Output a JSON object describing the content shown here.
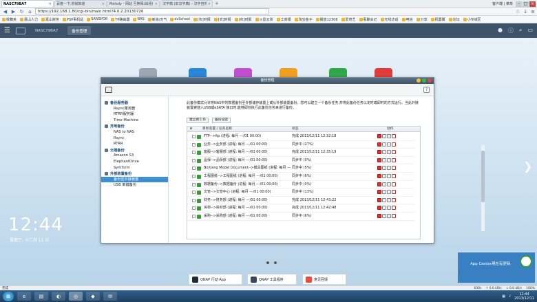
{
  "browser": {
    "tabs": [
      {
        "label": "NASC79BA7",
        "active": true
      },
      {
        "label": "百度一下,你就知道",
        "active": false
      },
      {
        "label": "Melody - 网站 互换网(出租)",
        "active": false
      },
      {
        "label": "汉字典 (旧汉字典) - 汉字自然",
        "active": false
      }
    ],
    "top_right_text": "客户端 | 菜单",
    "url": "https://192.168.1.80/cgi-bin/main.html?4.0.2.20130726",
    "bookmarks": [
      "收藏夹",
      "嘉山人力",
      "嘉山财务",
      "PSP事机站",
      "SANSPOR",
      "TP路由器",
      "NAS",
      "新浪/天气",
      "ecSchool",
      "[农]时报",
      "[农]时报",
      "[农]时报",
      "火星云资",
      "工商银",
      "淘宝金子",
      "播放12306",
      "爱奇艺",
      "看聚会记",
      "无线访谈",
      "电信",
      "分享",
      "机器翼",
      "论坛",
      "小专城区"
    ]
  },
  "qnap_bar": {
    "tab_label": "NASC79BA7",
    "backup_tab_label": "备份管理"
  },
  "desktop": {
    "clock": "12:44",
    "date": "星期三, 十二月 11 日",
    "dock": [
      {
        "label": "QNAP 行动 App"
      },
      {
        "label": "QNAP 工具程序"
      },
      {
        "label": "意见回馈"
      }
    ],
    "notification": "App Center現在有更新"
  },
  "window": {
    "title": "备份管理",
    "sidebar": [
      {
        "group": "备份服务器",
        "items": [
          "Rsync服务器",
          "RTRR服务器",
          "Time Machine"
        ]
      },
      {
        "group": "异地备份",
        "items": [
          "NAS to NAS",
          "Rsync",
          "RTRR"
        ]
      },
      {
        "group": "云端备份",
        "items": [
          "Amazon S3",
          "ElephantDrive",
          "Symform"
        ]
      },
      {
        "group": "外部装置备份",
        "items": [
          "备份至外接装置",
          "USB 单键备份"
        ]
      }
    ],
    "active_item": "备份至外接装置",
    "description": "此备份模式允许将NAS中的数据备份至外部储存装置上或从外部装置备份。您可以建立一个备份任务,并将此备份任务以定时或即时的方式运行。当此外接装置被插入USB或eSATA 接口时,能够即刻执行此备份任务来进行备份。",
    "buttons": {
      "create": "建立新工作",
      "options": "备份设定"
    },
    "columns": {
      "name": "目标装置 / 任务名称",
      "status": "状态",
      "action": "动作"
    },
    "rows": [
      {
        "name": "FTP-->ftp (进程: 每月 ---/01 00:00)",
        "status": "完成 2013/12/11 12:32:18"
      },
      {
        "name": "业务-->业务部 (进程: 每月 ---/01 00:00)",
        "status": "同步中 (27%)"
      },
      {
        "name": "客服-->客服部 (进程: 每月 ---/01 00:00)",
        "status": "完成 2013/12/11 12:35:19"
      },
      {
        "name": "品保-->品保部 (进程: 每月 ---/01 00:00)",
        "status": "同步中 (0%)"
      },
      {
        "name": "BoXiang Model Document-->模具图纸 (进程: 每月 ---/01 00:00)",
        "status": "同步中 (5%)"
      },
      {
        "name": "工程图纸-->工程图纸 (进程: 每月 ---/01 00:00)",
        "status": "同步中 (6%)"
      },
      {
        "name": "数据备份-->数据备份 (进程: 每月 ---/01 00:00)",
        "status": "同步中 (0%)"
      },
      {
        "name": "文管-->文管中心 (进程: 每月 ---/01 00:00)",
        "status": "同步中 (13%)"
      },
      {
        "name": "财务-->财务部 (进程: 每月 ---/01 00:00)",
        "status": "完成 2013/12/11 12:43:22"
      },
      {
        "name": "资材-->资材部 (进程: 每月 ---/01 00:00)",
        "status": "完成 2013/12/11 12:42:48"
      },
      {
        "name": "采购-->采购部 (进程: 每月 ---/01 00:00)",
        "status": "同步中 (6%)"
      }
    ]
  },
  "statusbar": {
    "left": "完成",
    "right_items": [
      "630s",
      "↑ 0.0 kB/s",
      "↓ 0.0 kB/s",
      "100%"
    ]
  },
  "taskbar": {
    "time": "12:44",
    "date": "2013/12/11"
  }
}
